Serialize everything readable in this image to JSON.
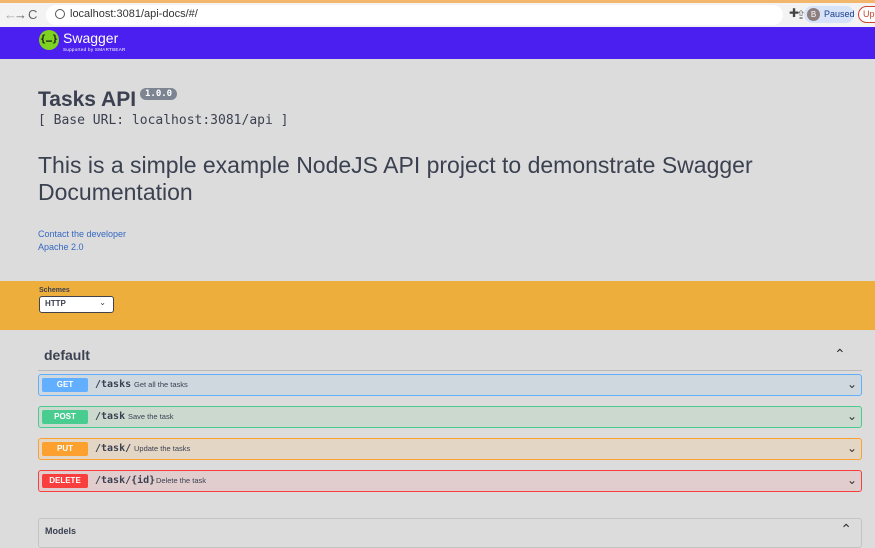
{
  "browser": {
    "url": "localhost:3081/api-docs/#/",
    "profile_initial": "B",
    "profile_label": "Paused",
    "update_label": "Up",
    "back_icon": "←",
    "forward_icon": "→",
    "reload_icon": "C"
  },
  "topbar": {
    "logo_symbol": "{…}",
    "logo_name": "Swagger",
    "logo_sub": "Supported by SMARTBEAR"
  },
  "info": {
    "title": "Tasks API",
    "version": "1.0.0",
    "base_url": "[ Base URL: localhost:3081/api ]",
    "description": "This is a simple example NodeJS API project to demonstrate Swagger Documentation",
    "contact_link": "Contact the developer",
    "license_link": "Apache 2.0"
  },
  "schemes": {
    "label": "Schemes",
    "selected": "HTTP"
  },
  "section": {
    "title": "default",
    "operations": [
      {
        "method": "GET",
        "path": "/tasks",
        "summary": "Get all the tasks"
      },
      {
        "method": "POST",
        "path": "/task",
        "summary": "Save the task"
      },
      {
        "method": "PUT",
        "path": "/task/",
        "summary": "Update the tasks"
      },
      {
        "method": "DELETE",
        "path": "/task/{id}",
        "summary": "Delete the task"
      }
    ]
  },
  "models": {
    "title": "Models"
  },
  "colors": {
    "topbar": "#4b1ff0",
    "schemes_bg": "#eeae3c",
    "get": "#61affe",
    "post": "#49cc90",
    "put": "#fca130",
    "delete": "#f93e3e"
  }
}
